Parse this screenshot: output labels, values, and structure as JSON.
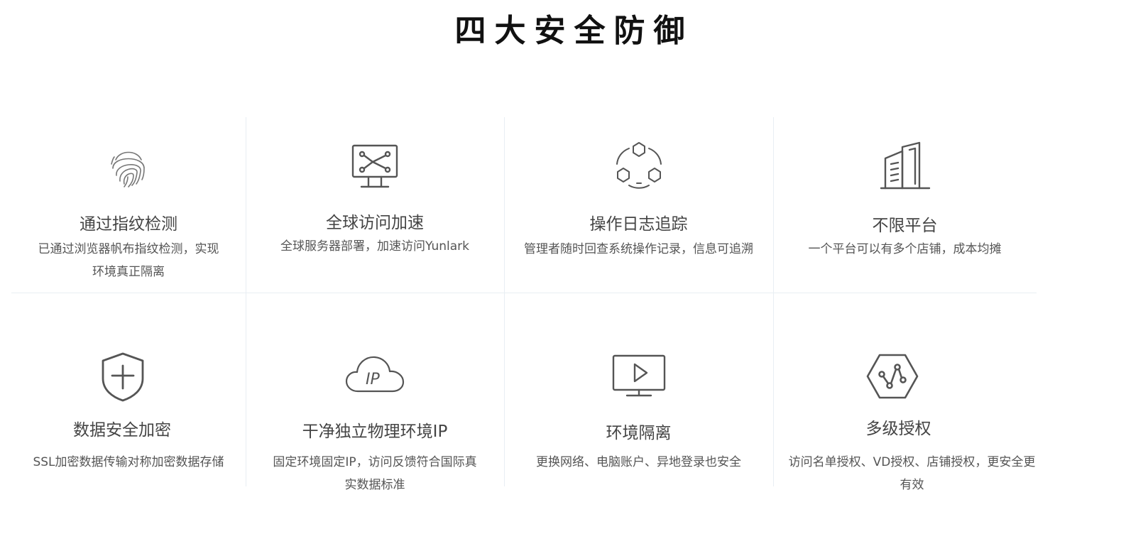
{
  "section": {
    "title": "四大安全防御"
  },
  "features": [
    {
      "title": "通过指纹检测",
      "desc": "已通过浏览器帆布指纹检测，实现环境真正隔离",
      "icon": "fingerprint-icon"
    },
    {
      "title": "全球访问加速",
      "desc": "全球服务器部署，加速访问Yunlark",
      "icon": "network-monitor-icon"
    },
    {
      "title": "操作日志追踪",
      "desc": "管理者随时回查系统操作记录，信息可追溯",
      "icon": "hexagon-cycle-icon"
    },
    {
      "title": "不限平台",
      "desc": "一个平台可以有多个店铺，成本均摊",
      "icon": "buildings-icon"
    },
    {
      "title": "数据安全加密",
      "desc": "SSL加密数据传输对称加密数据存储",
      "icon": "shield-plus-icon"
    },
    {
      "title": "干净独立物理环境IP",
      "desc": "固定环境固定IP，访问反馈符合国际真实数据标准",
      "icon": "cloud-ip-icon"
    },
    {
      "title": "环境隔离",
      "desc": "更换网络、电脑账户、异地登录也安全",
      "icon": "monitor-play-icon"
    },
    {
      "title": "多级授权",
      "desc": "访问名单授权、VD授权、店铺授权，更安全更有效",
      "icon": "hexagon-nodes-icon"
    }
  ],
  "colors": {
    "icon": "#555555",
    "title": "#444444",
    "divider": "#e8eef3"
  }
}
